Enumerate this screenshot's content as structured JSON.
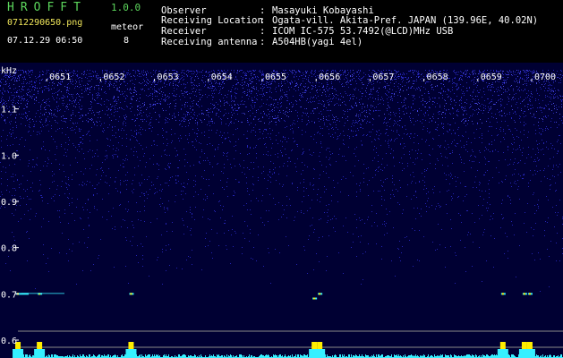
{
  "header": {
    "app_title": "HROFFT",
    "app_version": "1.0.0",
    "file_name": "0712290650.png",
    "datetime": "07.12.29 06:50",
    "meteor_label": "meteor",
    "meteor_count": "8"
  },
  "info": [
    {
      "label": "Observer",
      "value": "Masayuki Kobayashi"
    },
    {
      "label": "Receiving Location",
      "value": "Ogata-vill. Akita-Pref. JAPAN (139.96E, 40.02N)"
    },
    {
      "label": "Receiver",
      "value": "ICOM IC-575 53.7492(@LCD)MHz USB"
    },
    {
      "label": "Receiving antenna",
      "value": "A504HB(yagi 4el)"
    }
  ],
  "colors": {
    "text_green": "#5cd65c",
    "text_yellow": "#f0e65a",
    "text_white": "#ffffff",
    "background": "#000000",
    "plot_background": "#000033",
    "echo_cyan": "#36f0ff",
    "echo_yellow": "#ffee00"
  },
  "chart_data": {
    "type": "heatmap",
    "ylabel": "kHz",
    "x_ticks": [
      "0651",
      "0652",
      "0653",
      "0654",
      "0655",
      "0656",
      "0657",
      "0658",
      "0659",
      "0700"
    ],
    "xlim": [
      "0650",
      "0700"
    ],
    "y_ticks": [
      "1.1",
      "1.0",
      "0.9",
      "0.8",
      "0.7",
      "0.6"
    ],
    "ylim": [
      0.6,
      1.2
    ],
    "echo_band_khz": 0.7,
    "echoes": [
      {
        "time": "06:50.2",
        "freq_khz": 0.7
      },
      {
        "time": "06:50.6",
        "freq_khz": 0.7
      },
      {
        "time": "06:52.3",
        "freq_khz": 0.7
      },
      {
        "time": "06:55.7",
        "freq_khz": 0.69
      },
      {
        "time": "06:55.8",
        "freq_khz": 0.7
      },
      {
        "time": "06:59.2",
        "freq_khz": 0.7
      },
      {
        "time": "06:59.6",
        "freq_khz": 0.7
      },
      {
        "time": "06:59.7",
        "freq_khz": 0.7
      }
    ],
    "grid": false
  }
}
